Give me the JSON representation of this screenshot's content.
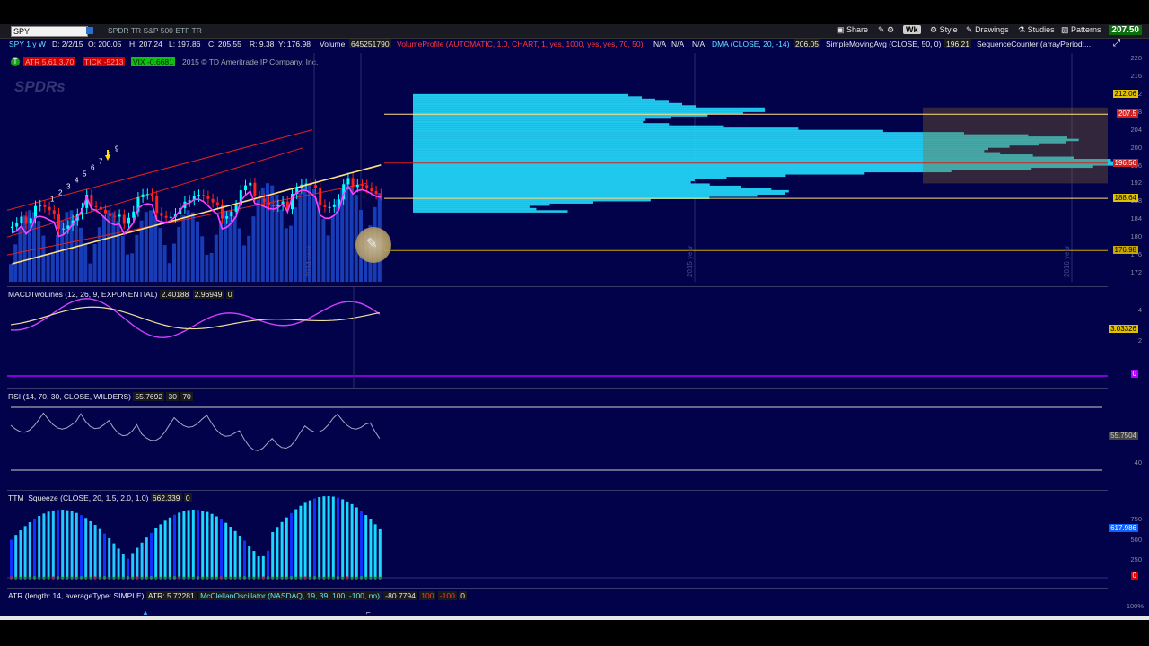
{
  "toolbar": {
    "symbol": "SPY",
    "description": "SPDR TR S&P 500 ETF TR",
    "share": "Share",
    "timeframe": "Wk",
    "style": "Style",
    "drawings": "Drawings",
    "studies": "Studies",
    "patterns": "Patterns",
    "last_price": "207.50"
  },
  "infoline": {
    "period": "SPY 1 y W",
    "date": "D: 2/2/15",
    "open": "O: 200.05",
    "high": "H: 207.24",
    "low": "L: 197.86",
    "close": "C: 205.55",
    "range": "R: 9.38",
    "yclose": "Y: 176.98",
    "volume_label": "Volume",
    "volume_value": "645251790",
    "vp": "VolumeProfile (AUTOMATIC, 1.0, CHART, 1, yes, 1000, yes, yes, 70, 50)",
    "na1": "N/A",
    "na2": "N/A",
    "na3": "N/A",
    "dma": "DMA (CLOSE, 20, -14)",
    "dma_value": "206.05",
    "sma": "SimpleMovingAvg (CLOSE, 50, 0)",
    "sma_value": "196.21",
    "seq": "SequenceCounter (arrayPeriod:..."
  },
  "line2": {
    "atr_badge": "ATR 5.61 3.70",
    "tick_badge": "TICK -5213",
    "vix_badge": "VIX -0.6681",
    "copyright": "2015 © TD Ameritrade IP Company, Inc."
  },
  "watermark": "SPDRs",
  "price_pane": {
    "ticks": [
      "220",
      "216",
      "212",
      "208",
      "204",
      "200",
      "196",
      "192",
      "188",
      "184",
      "180",
      "176",
      "172"
    ],
    "tags": [
      {
        "text": "212.06",
        "color": "#e0c000",
        "fg": "#000"
      },
      {
        "text": "207.5",
        "color": "#d42020",
        "fg": "#fff"
      },
      {
        "text": "196.56",
        "color": "#d42020",
        "fg": "#fff"
      },
      {
        "text": "188.64",
        "color": "#e0c000",
        "fg": "#000"
      },
      {
        "text": "176.98",
        "color": "#c8a800",
        "fg": "#000"
      }
    ],
    "year_labels": [
      "2014 year",
      "2015 year",
      "2016 year"
    ],
    "count_labels": [
      "1",
      "2",
      "3",
      "4",
      "5",
      "6",
      "7",
      "8",
      "9"
    ]
  },
  "macd": {
    "label": "MACDTwoLines (12, 26, 9, EXPONENTIAL)",
    "v1": "2.40188",
    "v2": "2.96949",
    "v3": "0",
    "ticks": [
      "4",
      "2"
    ],
    "tag": "3.03326",
    "zero_tag": "0"
  },
  "rsi": {
    "label": "RSI (14, 70, 30, CLOSE, WILDERS)",
    "value": "55.7692",
    "lo": "30",
    "hi": "70",
    "ticks": [
      "40"
    ],
    "tag": "55.7504"
  },
  "ttm": {
    "label": "TTM_Squeeze (CLOSE, 20, 1.5, 2.0, 1.0)",
    "value": "662.339",
    "v2": "0",
    "ticks": [
      "750",
      "500",
      "250"
    ],
    "tag": "617.986",
    "zero_tag": "0"
  },
  "bottom": {
    "atr": "ATR (length: 14, averageType: SIMPLE)",
    "atr_val": "ATR: 5.72281",
    "mco": "McClellanOscillator (NASDAQ, 19, 39, 100, -100, no)",
    "mco_val": "-80.7794",
    "p100": "100",
    "m100": "-100",
    "zero": "0",
    "pct": "100%"
  },
  "colors": {
    "background": "#02024a",
    "bull": "#00ffff",
    "bear": "#ff2020",
    "sma": "#ffe07a",
    "ema": "#ff40ff",
    "profile": "#22d3f5"
  }
}
